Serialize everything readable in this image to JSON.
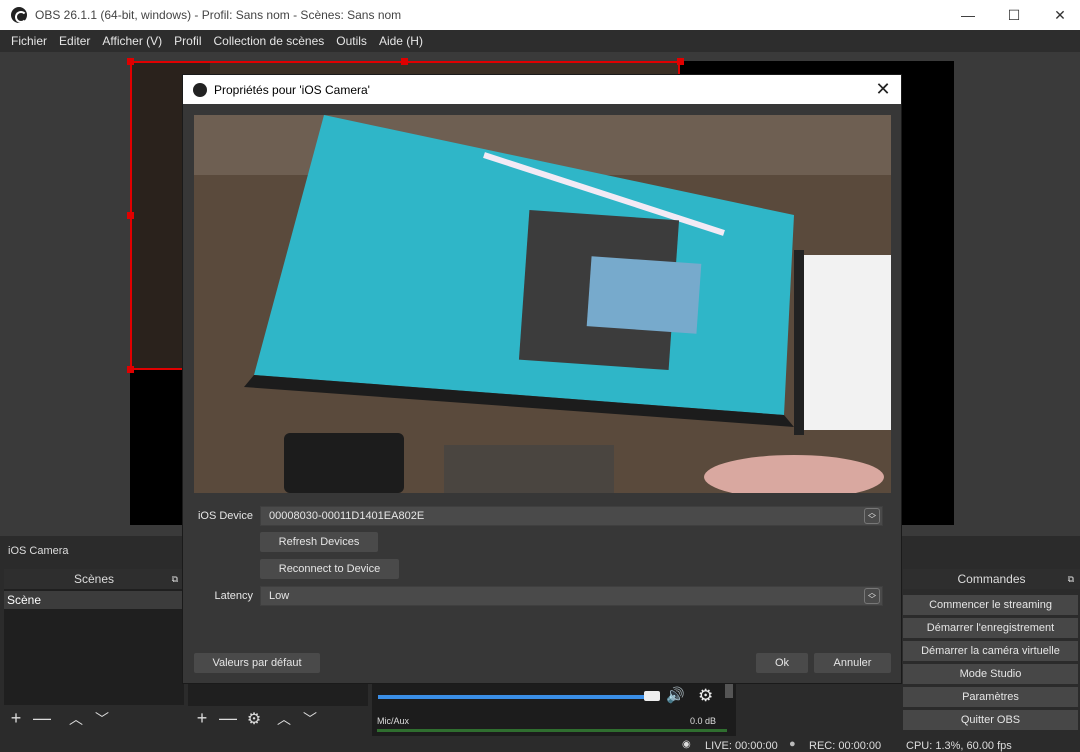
{
  "window": {
    "title": "OBS 26.1.1 (64-bit, windows) - Profil: Sans nom - Scènes: Sans nom",
    "minimize": "—",
    "maximize": "☐",
    "close": "✕"
  },
  "menu": [
    "Fichier",
    "Editer",
    "Afficher (V)",
    "Profil",
    "Collection de scènes",
    "Outils",
    "Aide (H)"
  ],
  "source_label": "iOS Camera",
  "scenes": {
    "title": "Scènes",
    "items": [
      "Scène"
    ]
  },
  "commands": {
    "title": "Commandes",
    "buttons": [
      "Commencer le streaming",
      "Démarrer l'enregistrement",
      "Démarrer la caméra virtuelle",
      "Mode Studio",
      "Paramètres",
      "Quitter OBS"
    ]
  },
  "mixer": {
    "channel": "Mic/Aux",
    "level": "0.0 dB",
    "volume_fraction": 0.98
  },
  "status": {
    "live": "LIVE: 00:00:00",
    "rec": "REC: 00:00:00",
    "cpu": "CPU: 1.3%, 60.00 fps"
  },
  "dialog": {
    "title": "Propriétés pour 'iOS Camera'",
    "device_label": "iOS Device",
    "device_value": "00008030-00011D1401EA802E",
    "refresh_label": "Refresh Devices",
    "reconnect_label": "Reconnect to Device",
    "latency_label": "Latency",
    "latency_value": "Low",
    "defaults_label": "Valeurs par défaut",
    "ok_label": "Ok",
    "cancel_label": "Annuler"
  },
  "icons": {
    "add": "+",
    "remove": "—",
    "up": "︿",
    "down": "﹀",
    "gear": "⚙",
    "speaker": "🔊"
  },
  "colors": {
    "selection_red": "#e00000",
    "meter_green": "#3caa3c",
    "volume_blue": "#3a8ee6"
  }
}
